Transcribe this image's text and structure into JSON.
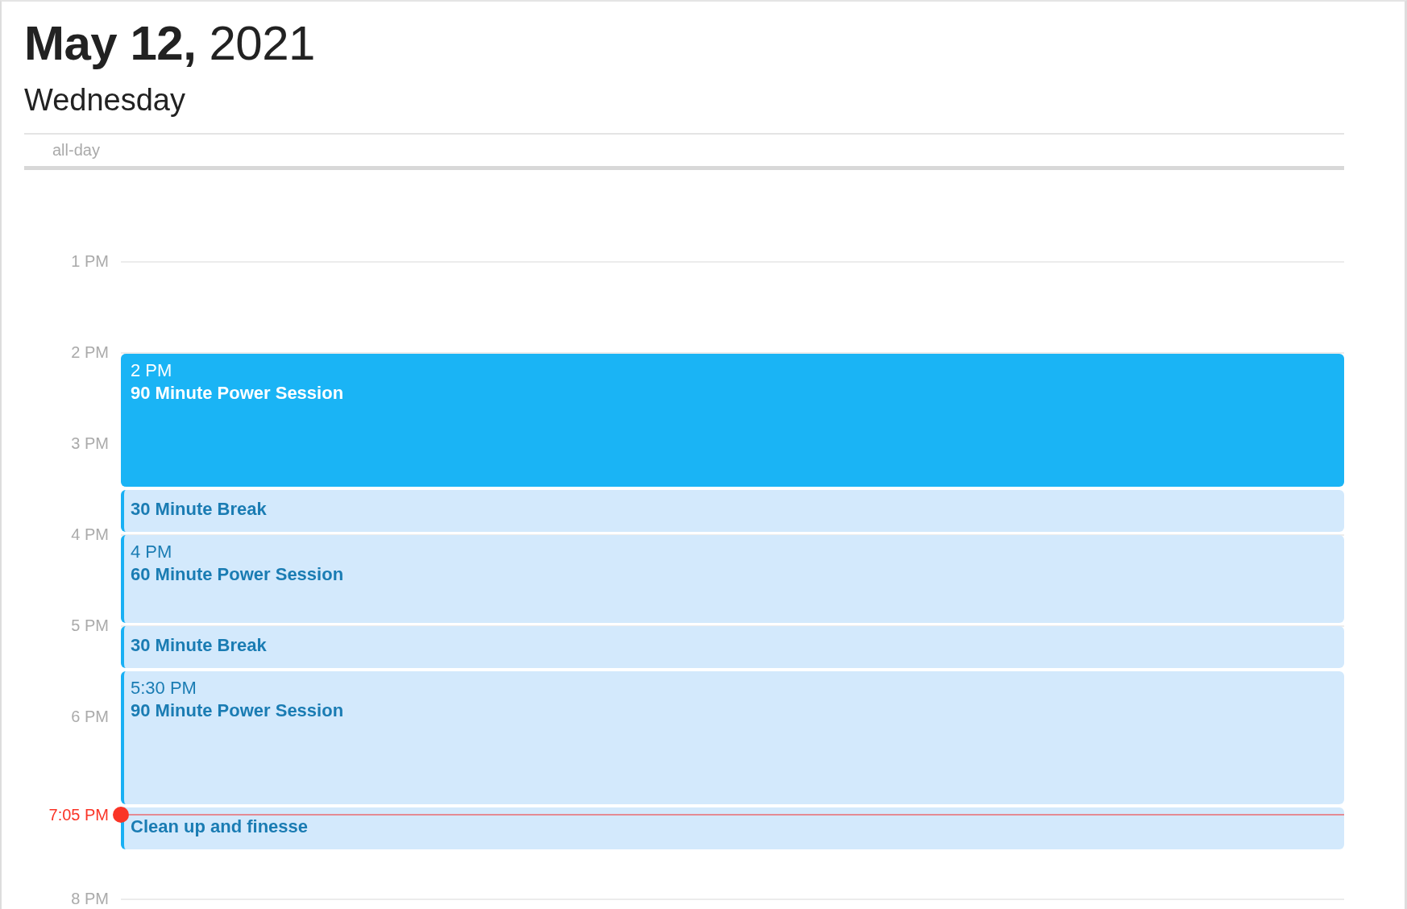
{
  "header": {
    "date": "**May 12,** 2021",
    "weekday": "Wednesday"
  },
  "all_day": {
    "label": "all-day"
  },
  "timeline": [
    {
      "kind": "hour",
      "label": "1 PM"
    },
    {
      "kind": "hour",
      "label": "2 PM"
    },
    {
      "kind": "hour",
      "label": "3 PM"
    },
    {
      "kind": "hour",
      "label": "4 PM"
    },
    {
      "kind": "hour",
      "label": "5 PM"
    },
    {
      "kind": "hour",
      "label": "6 PM"
    },
    {
      "kind": "now",
      "label": "7:05 PM"
    },
    {
      "kind": "hour",
      "label": "8 PM"
    }
  ],
  "events": [
    {
      "kind": "tall",
      "selected": true,
      "time": "2 PM",
      "title": "90 Minute Power Session"
    },
    {
      "kind": "short",
      "selected": false,
      "title": "30 Minute Break"
    },
    {
      "kind": "medium",
      "selected": false,
      "time": "4 PM",
      "title": "60 Minute Power Session"
    },
    {
      "kind": "short",
      "selected": false,
      "title": "30 Minute Break"
    },
    {
      "kind": "tall",
      "selected": false,
      "time": "5:30 PM",
      "title": "90 Minute Power Session"
    },
    {
      "kind": "short",
      "selected": false,
      "title": "Clean up and finesse"
    }
  ]
}
